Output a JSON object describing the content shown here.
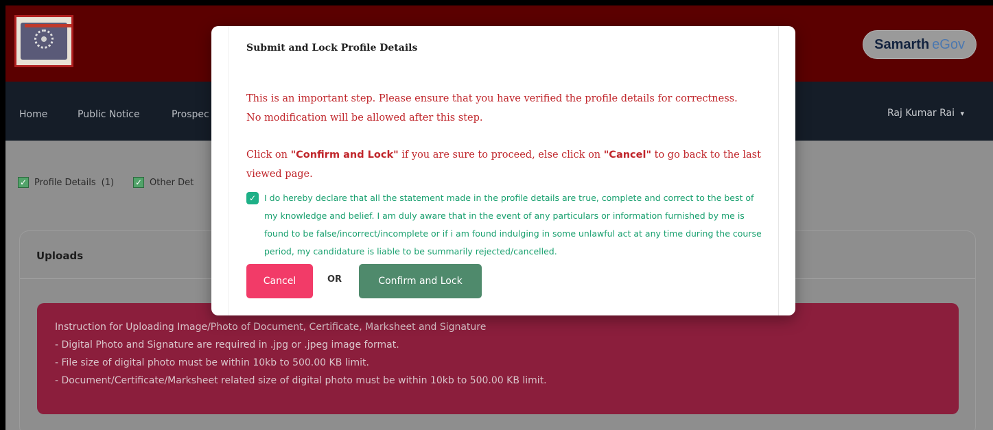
{
  "header": {
    "brand_primary": "Samarth",
    "brand_secondary": "eGov",
    "logo_icon": "university-emblem-icon"
  },
  "nav": {
    "items": [
      "Home",
      "Public Notice",
      "Prospec"
    ],
    "user_name": "Raj Kumar Rai",
    "user_caret": "▾"
  },
  "status": {
    "profile_label": "Profile Details",
    "profile_count": "(1)",
    "other_label": "Other Det"
  },
  "uploads": {
    "title": "Uploads",
    "instructions": [
      "Instruction for Uploading Image/Photo of Document, Certificate, Marksheet and Signature",
      "- Digital Photo and Signature are required in .jpg or .jpeg image format.",
      "- File size of digital photo must be within 10kb to 500.00 KB limit.",
      "- Document/Certificate/Marksheet related size of digital photo must be within 10kb to 500.00 KB limit."
    ]
  },
  "modal": {
    "title": "Submit and Lock Profile Details",
    "warning_line1": "This is an important step. Please ensure that you have verified the profile details for correctness.",
    "warning_line2": "No modification will be allowed after this step.",
    "instruction_prefix": "Click on ",
    "instruction_confirm": "\"Confirm and Lock\"",
    "instruction_middle": " if you are sure to proceed, else click on ",
    "instruction_cancel": "\"Cancel\"",
    "instruction_suffix": " to go back to the last viewed page.",
    "declaration": "I do hereby declare that all the statement made in the profile details are true, complete and correct to the best of my knowledge and belief. I am duly aware that in the event of any particulars or information furnished by me is found to be false/incorrect/incomplete or if i am found indulging in some unlawful act at any time during the course period, my candidature is liable to be summarily rejected/cancelled.",
    "declaration_checked": true,
    "cancel_label": "Cancel",
    "or_label": "OR",
    "confirm_label": "Confirm and Lock"
  },
  "colors": {
    "header_bg": "#5b0000",
    "nav_bg": "#151d28",
    "warning_text": "#c0262b",
    "declaration_text": "#19a06f",
    "cancel_button": "#f23b68",
    "confirm_button": "#4f8a6c",
    "notice_bg": "#8b1e3c"
  }
}
